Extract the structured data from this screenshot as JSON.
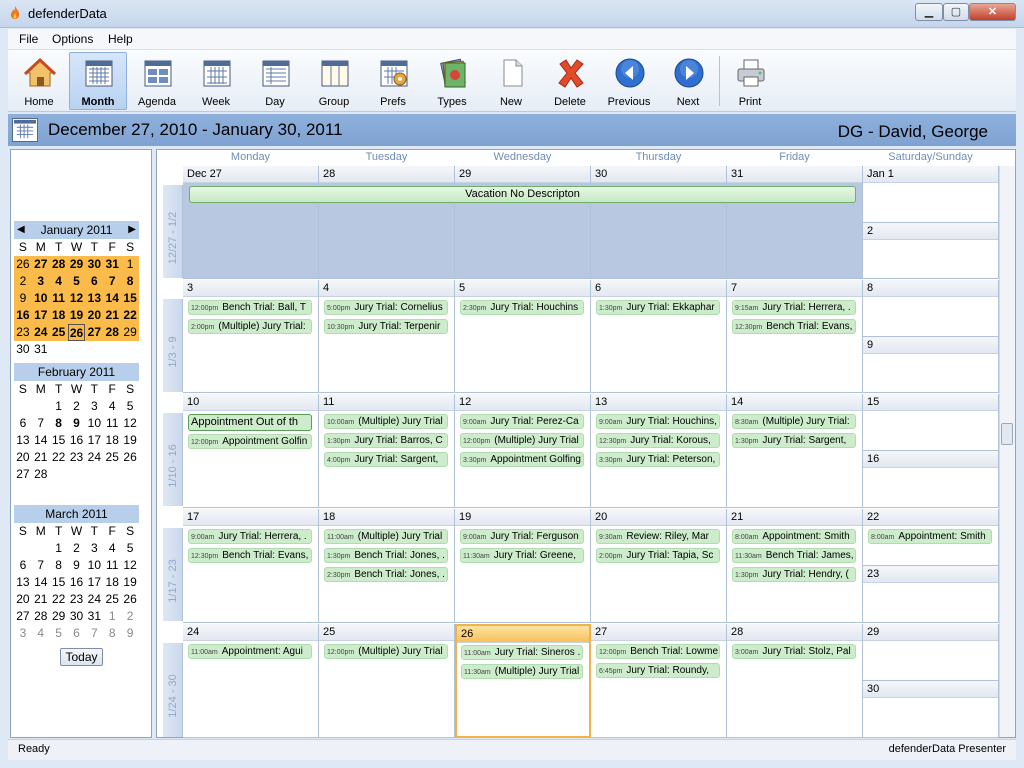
{
  "window": {
    "title": "defenderData",
    "min_label": "▁",
    "max_label": "▢",
    "close_label": "✕"
  },
  "menu": {
    "file": "File",
    "options": "Options",
    "help": "Help"
  },
  "toolbar": {
    "home": "Home",
    "month": "Month",
    "agenda": "Agenda",
    "week": "Week",
    "day": "Day",
    "group": "Group",
    "prefs": "Prefs",
    "types": "Types",
    "new": "New",
    "delete": "Delete",
    "previous": "Previous",
    "next": "Next",
    "print": "Print"
  },
  "header": {
    "date_range": "December 27, 2010 - January 30, 2011",
    "person": "DG - David, George"
  },
  "minicals": {
    "jan": {
      "title": "January 2011",
      "prev_icon": "triangle-left",
      "next_icon": "triangle-right"
    },
    "feb": {
      "title": "February 2011"
    },
    "mar": {
      "title": "March 2011"
    },
    "dow": [
      "S",
      "M",
      "T",
      "W",
      "T",
      "F",
      "S"
    ],
    "today_button": "Today"
  },
  "day_headers": [
    "Monday",
    "Tuesday",
    "Wednesday",
    "Thursday",
    "Friday",
    "Saturday/Sunday"
  ],
  "weeks": [
    {
      "label": "12/27 - 1/2",
      "days": [
        "Dec 27",
        "28",
        "29",
        "30",
        "31"
      ],
      "sat": "Jan 1",
      "sun": "2"
    },
    {
      "label": "1/3 - 9",
      "days": [
        "3",
        "4",
        "5",
        "6",
        "7"
      ],
      "sat": "8",
      "sun": "9"
    },
    {
      "label": "1/10 - 16",
      "days": [
        "10",
        "11",
        "12",
        "13",
        "14"
      ],
      "sat": "15",
      "sun": "16"
    },
    {
      "label": "1/17 - 23",
      "days": [
        "17",
        "18",
        "19",
        "20",
        "21"
      ],
      "sat": "22",
      "sun": "23"
    },
    {
      "label": "1/24 - 30",
      "days": [
        "24",
        "25",
        "26",
        "27",
        "28"
      ],
      "sat": "29",
      "sun": "30"
    }
  ],
  "vacation": "Vacation No Descripton",
  "appointments": {
    "w1": {
      "mon": [
        {
          "time": "12:00pm",
          "text": "Bench Trial: Ball, T"
        },
        {
          "time": "2:00pm",
          "text": "(Multiple) Jury Trial:"
        }
      ],
      "tue": [
        {
          "time": "5:00pm",
          "text": "Jury Trial: Cornelius"
        },
        {
          "time": "10:30pm",
          "text": "Jury Trial: Terpenir"
        }
      ],
      "wed": [
        {
          "time": "2:30pm",
          "text": "Jury Trial: Houchins"
        }
      ],
      "thu": [
        {
          "time": "1:30pm",
          "text": "Jury Trial: Ekkaphar"
        }
      ],
      "fri": [
        {
          "time": "9:15am",
          "text": "Jury Trial: Herrera, ."
        },
        {
          "time": "12:30pm",
          "text": "Bench Trial: Evans,"
        }
      ]
    },
    "w2": {
      "mon": [
        {
          "text": "Appointment Out of th"
        },
        {
          "time": "12:00pm",
          "text": "Appointment Golfin"
        }
      ],
      "tue": [
        {
          "time": "10:00am",
          "text": "(Multiple) Jury Trial"
        },
        {
          "time": "1:30pm",
          "text": "Jury Trial: Barros, C"
        },
        {
          "time": "4:00pm",
          "text": "Jury Trial: Sargent,"
        }
      ],
      "wed": [
        {
          "time": "9:00am",
          "text": "Jury Trial: Perez-Ca"
        },
        {
          "time": "12:00pm",
          "text": "(Multiple) Jury Trial"
        },
        {
          "time": "3:30pm",
          "text": "Appointment Golfing"
        }
      ],
      "thu": [
        {
          "time": "9:00am",
          "text": "Jury Trial: Houchins,"
        },
        {
          "time": "12:30pm",
          "text": "Jury Trial: Korous,"
        },
        {
          "time": "3:30pm",
          "text": "Jury Trial: Peterson,"
        }
      ],
      "fri": [
        {
          "time": "8:30am",
          "text": "(Multiple) Jury Trial:"
        },
        {
          "time": "1:30pm",
          "text": "Jury Trial: Sargent,"
        }
      ]
    },
    "w3": {
      "mon": [
        {
          "time": "9:00am",
          "text": "Jury Trial: Herrera, ."
        },
        {
          "time": "12:30pm",
          "text": "Bench Trial: Evans, ."
        }
      ],
      "tue": [
        {
          "time": "11:00am",
          "text": "(Multiple) Jury Trial"
        },
        {
          "time": "1:30pm",
          "text": "Bench Trial: Jones, ."
        },
        {
          "time": "2:30pm",
          "text": "Bench Trial: Jones, ."
        }
      ],
      "wed": [
        {
          "time": "9:00am",
          "text": "Jury Trial: Ferguson"
        },
        {
          "time": "11:30am",
          "text": "Jury Trial: Greene,"
        }
      ],
      "thu": [
        {
          "time": "9:30am",
          "text": "Review: Riley, Mar"
        },
        {
          "time": "2:00pm",
          "text": "Jury Trial: Tapia, Sc"
        }
      ],
      "fri": [
        {
          "time": "8:00am",
          "text": "Appointment: Smith"
        },
        {
          "time": "11:30am",
          "text": "Bench Trial: James,"
        },
        {
          "time": "1:30pm",
          "text": "Jury Trial: Hendry, ("
        }
      ],
      "sat": [
        {
          "time": "8:00am",
          "text": "Appointment: Smith"
        }
      ]
    },
    "w4": {
      "mon": [
        {
          "time": "11:00am",
          "text": "Appointment: Agui"
        }
      ],
      "tue": [
        {
          "time": "12:00pm",
          "text": "(Multiple) Jury Trial"
        }
      ],
      "wed": [
        {
          "time": "11:00am",
          "text": "Jury Trial: Sineros ."
        },
        {
          "time": "11:30am",
          "text": "(Multiple) Jury Trial"
        }
      ],
      "thu": [
        {
          "time": "12:00pm",
          "text": "Bench Trial: Lowme"
        },
        {
          "time": "6:45pm",
          "text": "Jury Trial: Roundy,"
        }
      ],
      "fri": [
        {
          "time": "3:00am",
          "text": "Jury Trial: Stolz, Pal"
        }
      ]
    }
  },
  "status": {
    "left": "Ready",
    "right": "defenderData Presenter"
  }
}
